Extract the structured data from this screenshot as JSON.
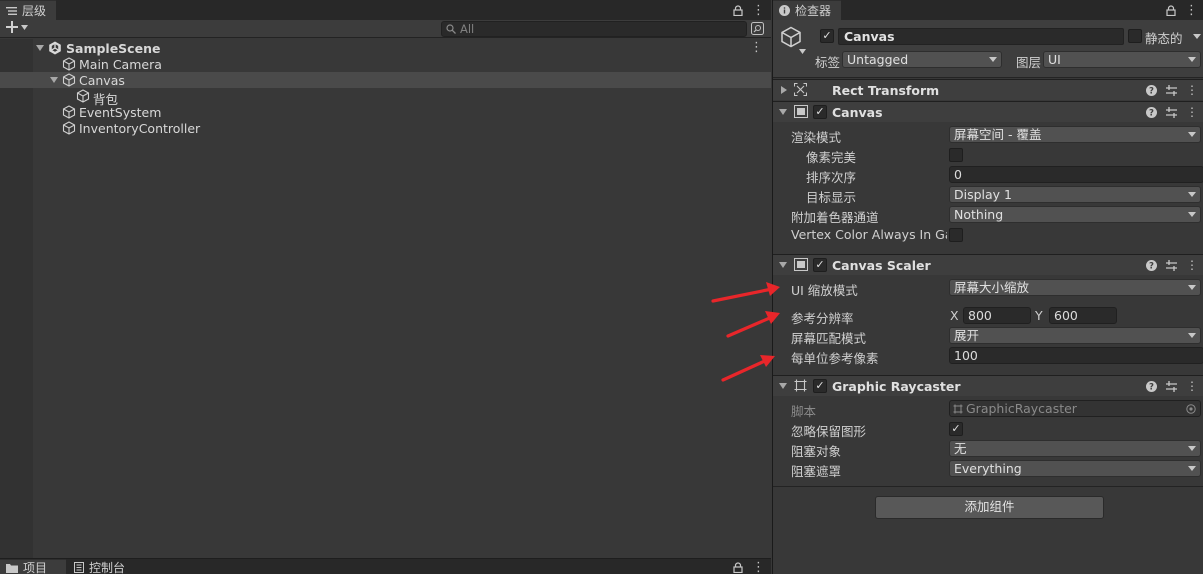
{
  "hierarchy": {
    "tab_label": "层级",
    "search_placeholder": "All",
    "scene_name": "SampleScene",
    "items": [
      {
        "label": "Main Camera"
      },
      {
        "label": "Canvas"
      },
      {
        "label": "背包"
      },
      {
        "label": "EventSystem"
      },
      {
        "label": "InventoryController"
      }
    ]
  },
  "bottom_tabs": {
    "project": "项目",
    "console": "控制台"
  },
  "inspector": {
    "tab_label": "检查器",
    "object_name": "Canvas",
    "static_label": "静态的",
    "tag_label": "标签",
    "tag_value": "Untagged",
    "layer_label": "图层",
    "layer_value": "UI",
    "rect_transform": {
      "title": "Rect Transform"
    },
    "canvas": {
      "title": "Canvas",
      "render_mode_label": "渲染模式",
      "render_mode_value": "屏幕空间 - 覆盖",
      "pixel_perfect_label": "像素完美",
      "sort_order_label": "排序次序",
      "sort_order_value": "0",
      "target_display_label": "目标显示",
      "target_display_value": "Display 1",
      "shader_channels_label": "附加着色器通道",
      "shader_channels_value": "Nothing",
      "vertex_color_label": "Vertex Color Always In Gar"
    },
    "canvas_scaler": {
      "title": "Canvas Scaler",
      "ui_scale_mode_label": "UI 缩放模式",
      "ui_scale_mode_value": "屏幕大小缩放",
      "ref_resolution_label": "参考分辨率",
      "x_label": "X",
      "x_value": "800",
      "y_label": "Y",
      "y_value": "600",
      "screen_match_label": "屏幕匹配模式",
      "screen_match_value": "展开",
      "ref_pixels_label": "每单位参考像素",
      "ref_pixels_value": "100"
    },
    "graphic_raycaster": {
      "title": "Graphic Raycaster",
      "script_label": "脚本",
      "script_value": "GraphicRaycaster",
      "ignore_reversed_label": "忽略保留图形",
      "blocking_objects_label": "阻塞对象",
      "blocking_objects_value": "无",
      "blocking_mask_label": "阻塞遮罩",
      "blocking_mask_value": "Everything"
    },
    "add_component_label": "添加组件"
  },
  "colors": {
    "annotation_arrow": "#e8262a",
    "panel_bg": "#383838",
    "selected_row": "#4a4a4a"
  }
}
